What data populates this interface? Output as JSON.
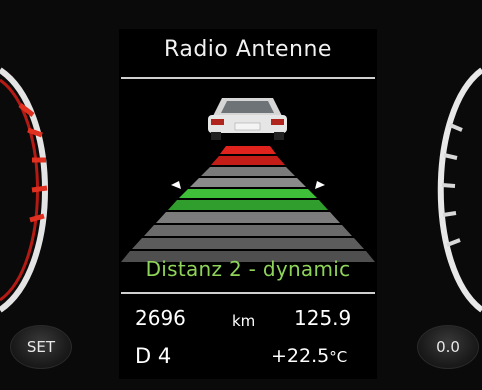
{
  "display": {
    "title": "Radio Antenne",
    "status": "Distanz 2 - dynamic",
    "odometer": "2696",
    "odometer_unit": "km",
    "trip": "125.9",
    "gear": "D 4",
    "temperature": "+22.5",
    "temperature_unit": "°C"
  },
  "buttons": {
    "set_label": "SET",
    "reset_label": "0.0"
  },
  "colors": {
    "status_text": "#8fd45a",
    "near_zone": "#d9231f",
    "active_zone": "#35b83a",
    "idle_zone": "#707070"
  }
}
